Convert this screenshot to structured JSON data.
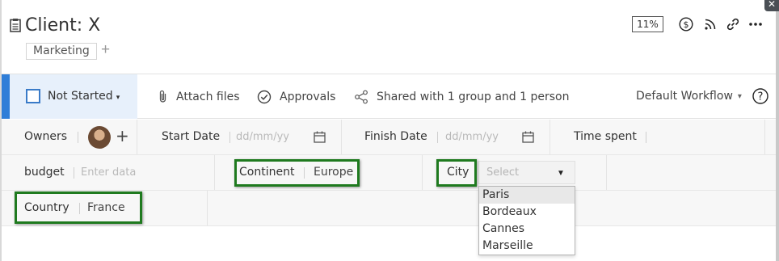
{
  "header": {
    "title": "Client: X",
    "tag": "Marketing",
    "add_tag_glyph": "+",
    "progress_badge": "11%",
    "icons": [
      "dollar-icon",
      "rss-icon",
      "link-icon",
      "more-icon"
    ]
  },
  "window": {
    "close_glyph": "✕"
  },
  "toolbar": {
    "status_label": "Not Started",
    "status_caret": "▾",
    "attach_label": "Attach files",
    "approvals_label": "Approvals",
    "shared_label": "Shared with 1 group and 1 person",
    "workflow_label": "Default Workflow",
    "workflow_caret": "▾",
    "help_glyph": "?"
  },
  "fields": {
    "owners_label": "Owners",
    "add_owner_glyph": "+",
    "start_date_label": "Start Date",
    "start_date_placeholder": "dd/mm/yy",
    "finish_date_label": "Finish Date",
    "finish_date_placeholder": "dd/mm/yy",
    "time_spent_label": "Time spent",
    "budget_label": "budget",
    "budget_placeholder": "Enter data",
    "continent_label": "Continent",
    "continent_value": "Europe",
    "city_label": "City",
    "city_placeholder": "Select",
    "city_arrow": "▼",
    "country_label": "Country",
    "country_value": "France"
  },
  "city_dropdown": {
    "options": [
      "Paris",
      "Bordeaux",
      "Cannes",
      "Marseille"
    ],
    "highlighted": "Paris"
  },
  "colors": {
    "accent_blue": "#2f7ed8",
    "status_bg": "#e7f0fb",
    "highlight_green": "#1f7a1f"
  }
}
